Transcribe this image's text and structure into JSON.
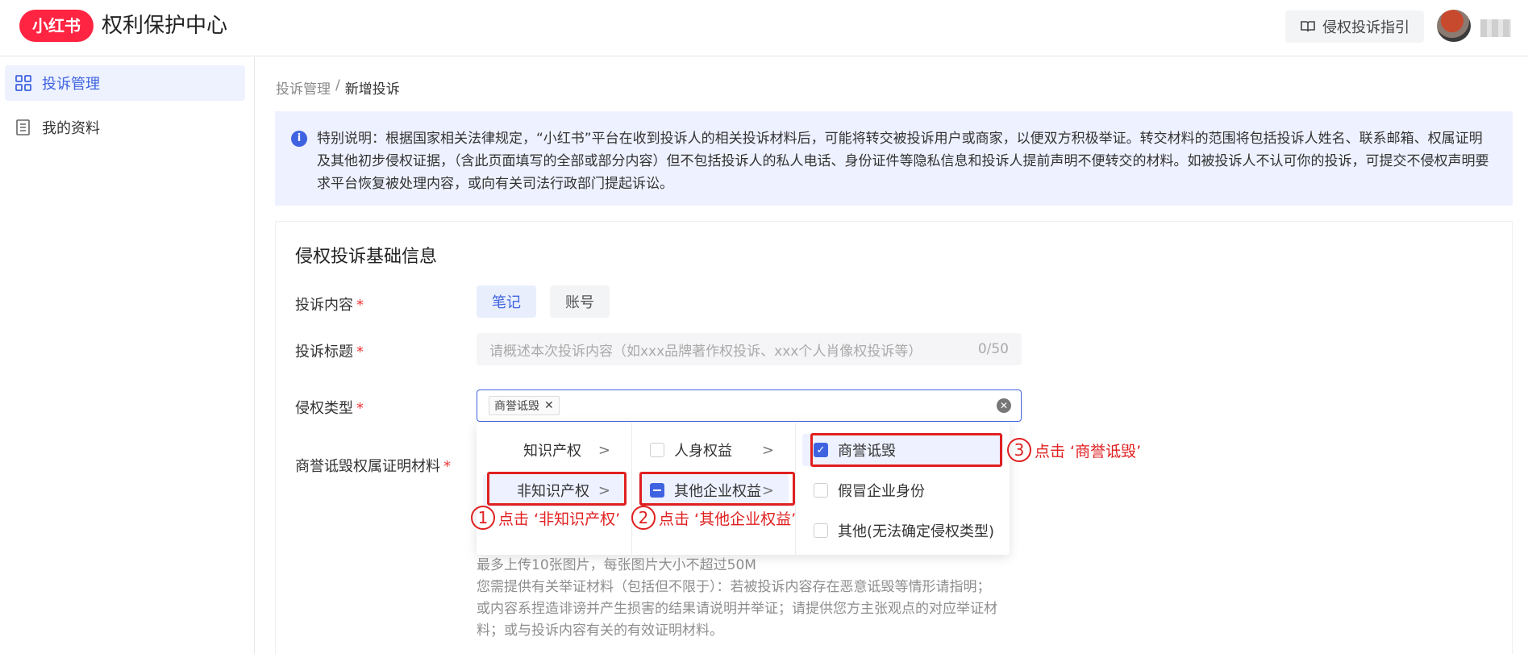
{
  "header": {
    "logo_text": "小红书",
    "site_title": "权利保护中心",
    "guide_label": "侵权投诉指引",
    "accent_color": "#ff2442"
  },
  "sidebar": {
    "items": [
      {
        "label": "投诉管理",
        "icon": "grid-icon",
        "active": true
      },
      {
        "label": "我的资料",
        "icon": "document-icon",
        "active": false
      }
    ]
  },
  "breadcrumb": {
    "parent": "投诉管理",
    "separator": "/",
    "current": "新增投诉"
  },
  "notice": {
    "text": "特别说明：根据国家相关法律规定，“小红书”平台在收到投诉人的相关投诉材料后，可能将转交被投诉用户或商家，以便双方积极举证。转交材料的范围将包括投诉人姓名、联系邮箱、权属证明及其他初步侵权证据，（含此页面填写的全部或部分内容）但不包括投诉人的私人电话、身份证件等隐私信息和投诉人提前声明不便转交的材料。如被投诉人不认可你的投诉，可提交不侵权声明要求平台恢复被处理内容，或向有关司法行政部门提起诉讼。"
  },
  "form": {
    "section_title": "侵权投诉基础信息",
    "content_label": "投诉内容",
    "content_options": [
      "笔记",
      "账号"
    ],
    "title_label": "投诉标题",
    "title_placeholder": "请概述本次投诉内容（如xxx品牌著作权投诉、xxx个人肖像权投诉等）",
    "title_count": "0/50",
    "type_label": "侵权类型",
    "type_tag": "商誉诋毁",
    "proof_label": "商誉诋毁权属证明材料",
    "required_mark": "*"
  },
  "cascader": {
    "col1": [
      {
        "label": "知识产权",
        "arrow": ">"
      },
      {
        "label": "非知识产权",
        "arrow": ">"
      }
    ],
    "col2": [
      {
        "label": "人身权益",
        "arrow": ">"
      },
      {
        "label": "其他企业权益",
        "arrow": ">"
      }
    ],
    "col3": [
      {
        "label": "商誉诋毁",
        "checked": true
      },
      {
        "label": "假冒企业身份",
        "checked": false
      },
      {
        "label": "其他(无法确定侵权类型)",
        "checked": false
      }
    ]
  },
  "annotations": {
    "step1": {
      "num": "1",
      "text": "点击 ‘非知识产权’"
    },
    "step2": {
      "num": "2",
      "text": "点击 ‘其他企业权益’"
    },
    "step3": {
      "num": "3",
      "text": "点击 ‘商誉诋毁’"
    },
    "color": "#e02020"
  },
  "hints": {
    "line1": "最多上传10张图片，每张图片大小不超过50M",
    "line2": "您需提供有关举证材料（包括但不限于）：若被投诉内容存在恶意诋毁等情形请指明；",
    "line3": "或内容系捏造诽谤并产生损害的结果请说明并举证；请提供您方主张观点的对应举证材",
    "line4": "料；或与投诉内容有关的有效证明材料。"
  }
}
